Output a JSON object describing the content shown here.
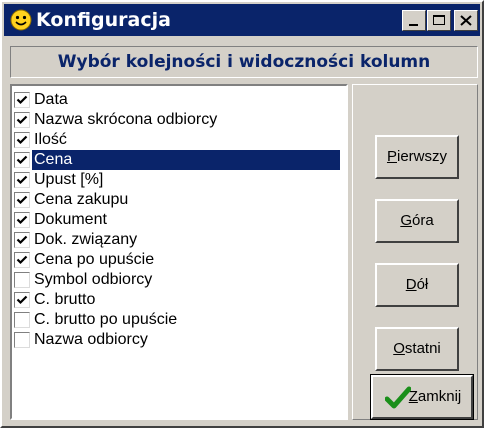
{
  "window": {
    "title": "Konfiguracja",
    "icon": "smiley-icon"
  },
  "titlebar_buttons": [
    "minimize-icon",
    "maximize-icon",
    "close-icon"
  ],
  "header": "Wybór kolejności i widoczności kolumn",
  "columns": [
    {
      "label": "Data",
      "checked": true,
      "selected": false
    },
    {
      "label": "Nazwa skrócona odbiorcy",
      "checked": true,
      "selected": false
    },
    {
      "label": "Ilość",
      "checked": true,
      "selected": false
    },
    {
      "label": "Cena",
      "checked": true,
      "selected": true
    },
    {
      "label": "Upust [%]",
      "checked": true,
      "selected": false
    },
    {
      "label": "Cena zakupu",
      "checked": true,
      "selected": false
    },
    {
      "label": "Dokument",
      "checked": true,
      "selected": false
    },
    {
      "label": "Dok. związany",
      "checked": true,
      "selected": false
    },
    {
      "label": "Cena po upuście",
      "checked": true,
      "selected": false
    },
    {
      "label": "Symbol odbiorcy",
      "checked": false,
      "selected": false
    },
    {
      "label": "C. brutto",
      "checked": true,
      "selected": false
    },
    {
      "label": "C. brutto po upuście",
      "checked": false,
      "selected": false
    },
    {
      "label": "Nazwa odbiorcy",
      "checked": false,
      "selected": false
    }
  ],
  "buttons": {
    "first": {
      "label": "Pierwszy",
      "mnemonic": "P",
      "rest": "ierwszy"
    },
    "up": {
      "label": "Góra",
      "mnemonic": "G",
      "rest": "óra"
    },
    "down": {
      "label": "Dół",
      "mnemonic": "D",
      "rest": "ół"
    },
    "last": {
      "label": "Ostatni",
      "mnemonic": "O",
      "rest": "statni"
    },
    "close": {
      "label": "Zamknij",
      "mnemonic": "Z",
      "rest": "amknij",
      "icon": "checkmark-icon"
    }
  },
  "colors": {
    "titlebar": "#0a246a",
    "face": "#d4d0c8",
    "header_text": "#0a246a",
    "check_icon": "#1a8f1a"
  }
}
